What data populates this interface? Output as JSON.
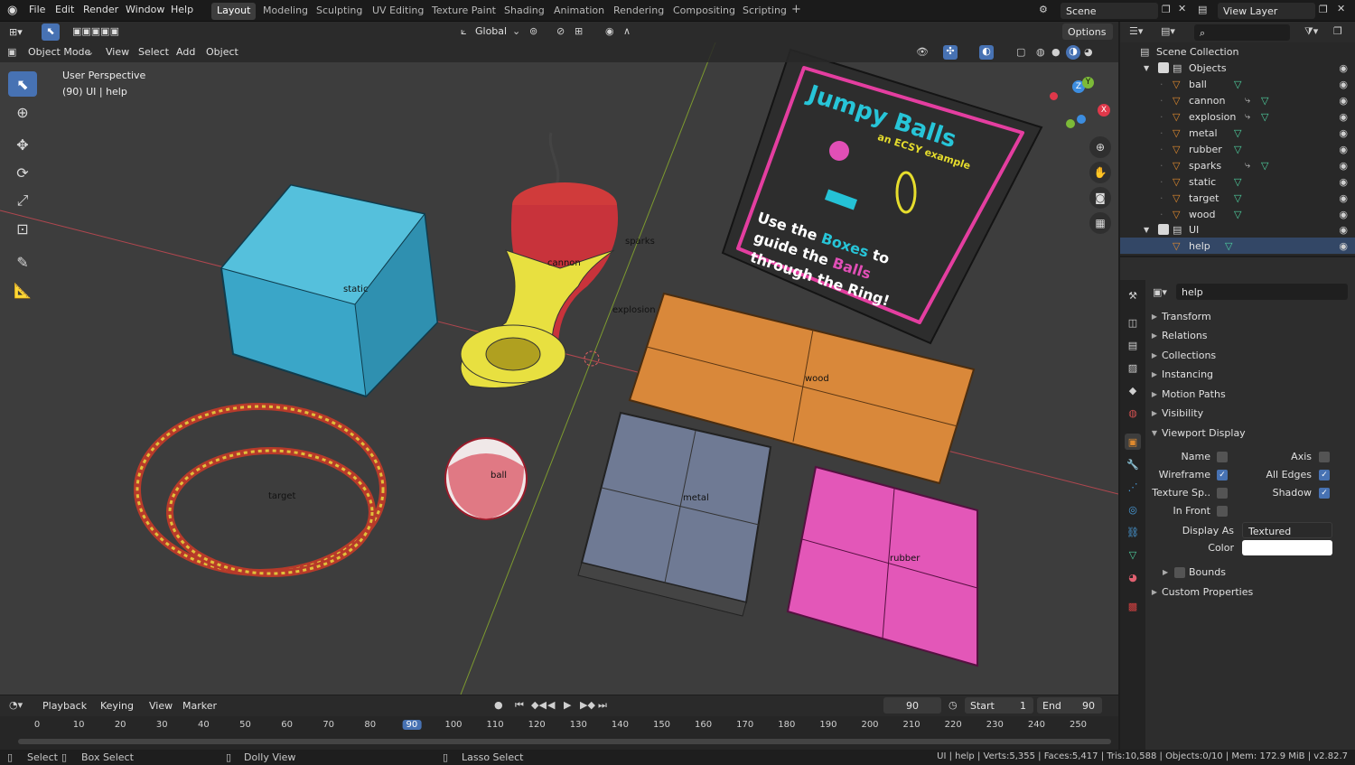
{
  "menu": {
    "file": "File",
    "edit": "Edit",
    "render": "Render",
    "window": "Window",
    "help": "Help"
  },
  "workspaces": [
    "Layout",
    "Modeling",
    "Sculpting",
    "UV Editing",
    "Texture Paint",
    "Shading",
    "Animation",
    "Rendering",
    "Compositing",
    "Scripting"
  ],
  "workspace_add": "+",
  "scene": {
    "label": "Scene"
  },
  "view_layer": {
    "label": "View Layer"
  },
  "tool_header": {
    "orientation": "Global",
    "options": "Options"
  },
  "viewport_header": {
    "mode": "Object Mode",
    "view": "View",
    "select": "Select",
    "add": "Add",
    "object": "Object"
  },
  "viewport": {
    "perspective": "User Perspective",
    "info": "(90) UI | help",
    "object_labels": {
      "static": "static",
      "cannon": "cannon",
      "sparks": "sparks",
      "explosion": "explosion",
      "wood": "wood",
      "target": "target",
      "ball": "ball",
      "metal": "metal",
      "rubber": "rubber"
    },
    "help_sign": {
      "title": "Jumpy Balls",
      "subtitle": "an ECSY example",
      "line1_a": "Use the ",
      "line1_b": "Boxes",
      "line1_c": " to",
      "line2_a": "guide the ",
      "line2_b": "Balls",
      "line3": "through the Ring!"
    },
    "gizmo": {
      "x": "X",
      "y": "Y",
      "z": "Z"
    }
  },
  "outliner": {
    "root": "Scene Collection",
    "collections": [
      {
        "name": "Objects",
        "items": [
          "ball",
          "cannon",
          "explosion",
          "metal",
          "rubber",
          "sparks",
          "static",
          "target",
          "wood"
        ]
      },
      {
        "name": "UI",
        "items": [
          "help"
        ]
      }
    ]
  },
  "properties": {
    "header_object": "help",
    "object_name": "help",
    "panels": [
      "Transform",
      "Relations",
      "Collections",
      "Instancing",
      "Motion Paths",
      "Visibility",
      "Viewport Display"
    ],
    "viewport_display": {
      "name": "Name",
      "axis": "Axis",
      "wireframe": "Wireframe",
      "all_edges": "All Edges",
      "texture_space": "Texture Sp..",
      "shadow": "Shadow",
      "in_front": "In Front",
      "display_as_label": "Display As",
      "display_as_value": "Textured",
      "color_label": "Color",
      "bounds": "Bounds",
      "color": "#ffffff"
    },
    "custom_properties": "Custom Properties"
  },
  "timeline": {
    "playback": "Playback",
    "keying": "Keying",
    "view": "View",
    "marker": "Marker",
    "current_frame": "90",
    "start_label": "Start",
    "start": "1",
    "end_label": "End",
    "end": "90",
    "ticks": [
      "0",
      "10",
      "20",
      "30",
      "40",
      "50",
      "60",
      "70",
      "80",
      "90",
      "100",
      "110",
      "120",
      "130",
      "140",
      "150",
      "160",
      "170",
      "180",
      "190",
      "200",
      "210",
      "220",
      "230",
      "240",
      "250"
    ]
  },
  "status": {
    "select": "Select",
    "box_select": "Box Select",
    "dolly": "Dolly View",
    "lasso": "Lasso Select",
    "stats": "UI | help | Verts:5,355 | Faces:5,417 | Tris:10,588 | Objects:0/10 | Mem: 172.9 MiB | v2.82.7"
  },
  "colors": {
    "accent": "#4772b3",
    "background": "#3d3d3d",
    "orange": "#e08a2e",
    "playhead": "#4772b3"
  }
}
